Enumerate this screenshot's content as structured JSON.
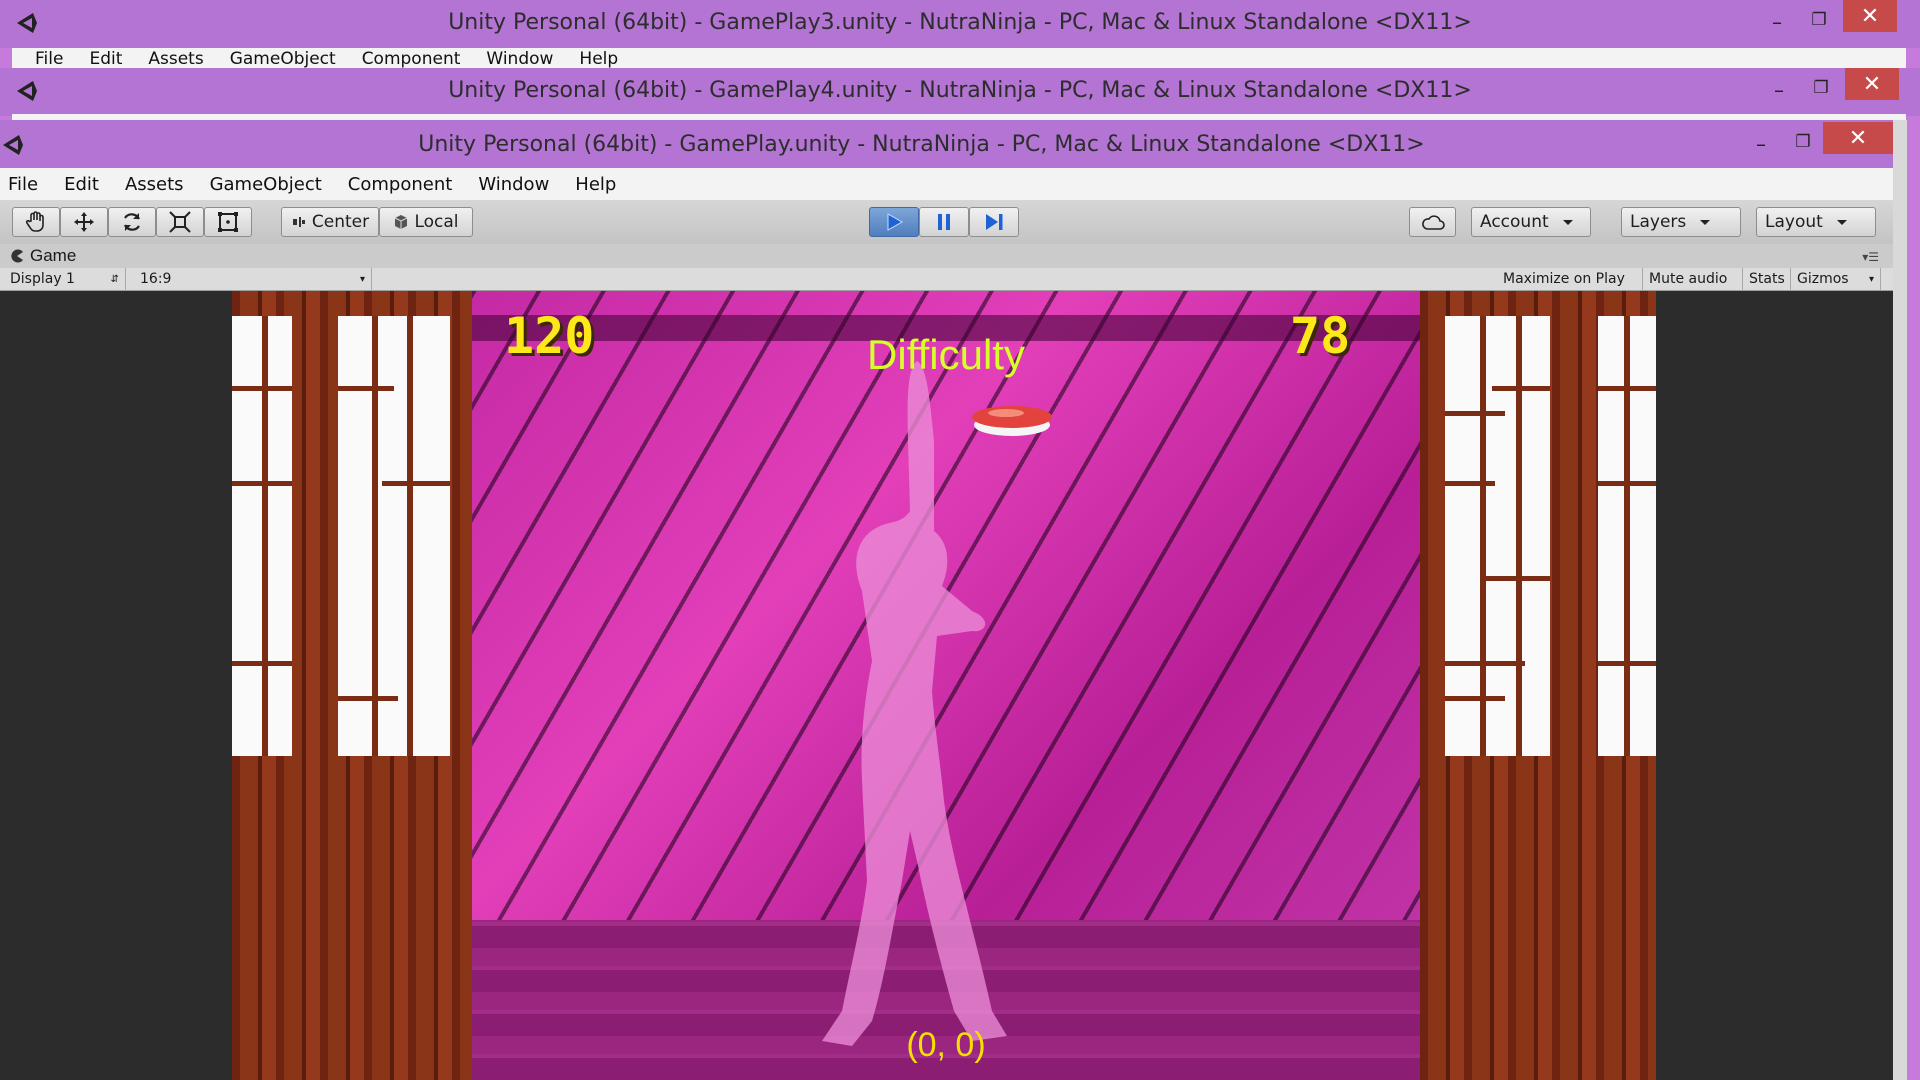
{
  "windows": {
    "back1": {
      "title": "Unity Personal (64bit) - GamePlay3.unity - NutraNinja - PC, Mac & Linux Standalone <DX11>",
      "menu": [
        "File",
        "Edit",
        "Assets",
        "GameObject",
        "Component",
        "Window",
        "Help"
      ]
    },
    "back2": {
      "title": "Unity Personal (64bit) - GamePlay4.unity - NutraNinja - PC, Mac & Linux Standalone <DX11>"
    },
    "main": {
      "title": "Unity Personal (64bit) - GamePlay.unity - NutraNinja - PC, Mac & Linux Standalone <DX11>",
      "menu": [
        "File",
        "Edit",
        "Assets",
        "GameObject",
        "Component",
        "Window",
        "Help"
      ]
    }
  },
  "toolbar": {
    "pivot_label": "Center",
    "space_label": "Local",
    "account_label": "Account",
    "layers_label": "Layers",
    "layout_label": "Layout"
  },
  "game_tab": {
    "title": "Game",
    "display": "Display 1",
    "aspect": "16:9",
    "maximize": "Maximize on Play",
    "mute": "Mute audio",
    "stats": "Stats",
    "gizmos": "Gizmos"
  },
  "game": {
    "score_left": "120",
    "score_right": "78",
    "difficulty_label": "Difficulty",
    "coords": "(0, 0)"
  },
  "colors": {
    "titlebar": "#b374d3",
    "close": "#c74a4a",
    "play_active": "#4f7fbd",
    "score": "#ffe81a",
    "hud_text": "#d7ff2a"
  }
}
